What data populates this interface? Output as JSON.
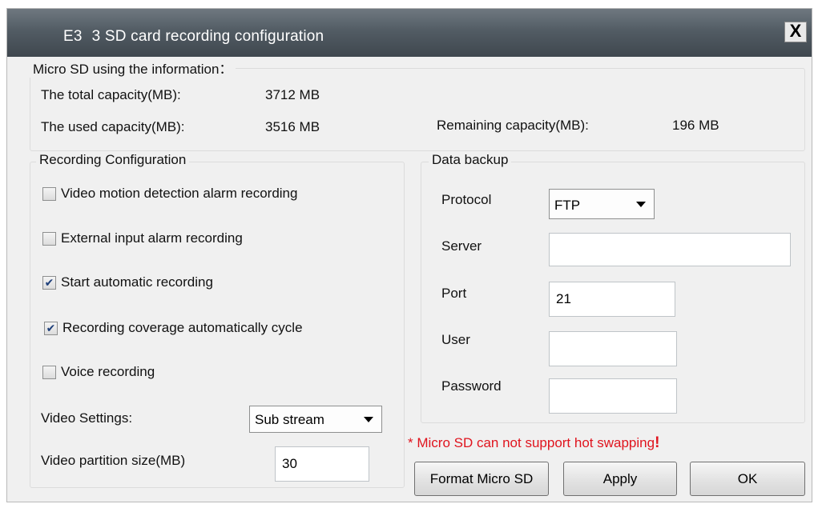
{
  "window": {
    "title": "E3   3 SD card recording configuration",
    "close_glyph": "X"
  },
  "sd_info": {
    "heading": "Micro SD using the information：",
    "total_label": "The total capacity(MB):",
    "total_value": "3712 MB",
    "used_label": "The used capacity(MB):",
    "used_value": "3516 MB",
    "remaining_label": "Remaining capacity(MB):",
    "remaining_value": "196 MB"
  },
  "recording": {
    "legend": "Recording Configuration",
    "options": [
      {
        "label": "Video motion detection alarm recording",
        "checked": false
      },
      {
        "label": "External input alarm recording",
        "checked": false
      },
      {
        "label": "Start automatic recording",
        "checked": true
      },
      {
        "label": "Recording coverage automatically cycle",
        "checked": true
      },
      {
        "label": "Voice recording",
        "checked": false
      }
    ],
    "video_settings_label": "Video Settings:",
    "video_settings_value": "Sub stream",
    "partition_label": "Video partition size(MB)",
    "partition_value": "30"
  },
  "backup": {
    "legend": "Data backup",
    "protocol_label": "Protocol",
    "protocol_value": "FTP",
    "server_label": "Server",
    "server_value": "",
    "port_label": "Port",
    "port_value": "21",
    "user_label": "User",
    "user_value": "",
    "password_label": "Password",
    "password_value": ""
  },
  "warning": {
    "star": "*",
    "text": " Micro SD can not support hot swapping",
    "bang": "!"
  },
  "buttons": {
    "format": "Format Micro SD",
    "apply": "Apply",
    "ok": "OK"
  },
  "colors": {
    "titlebar": "#525c64",
    "dialog_bg": "#f0f0f0",
    "warning": "#e0141e",
    "check": "#1e3f7a"
  }
}
